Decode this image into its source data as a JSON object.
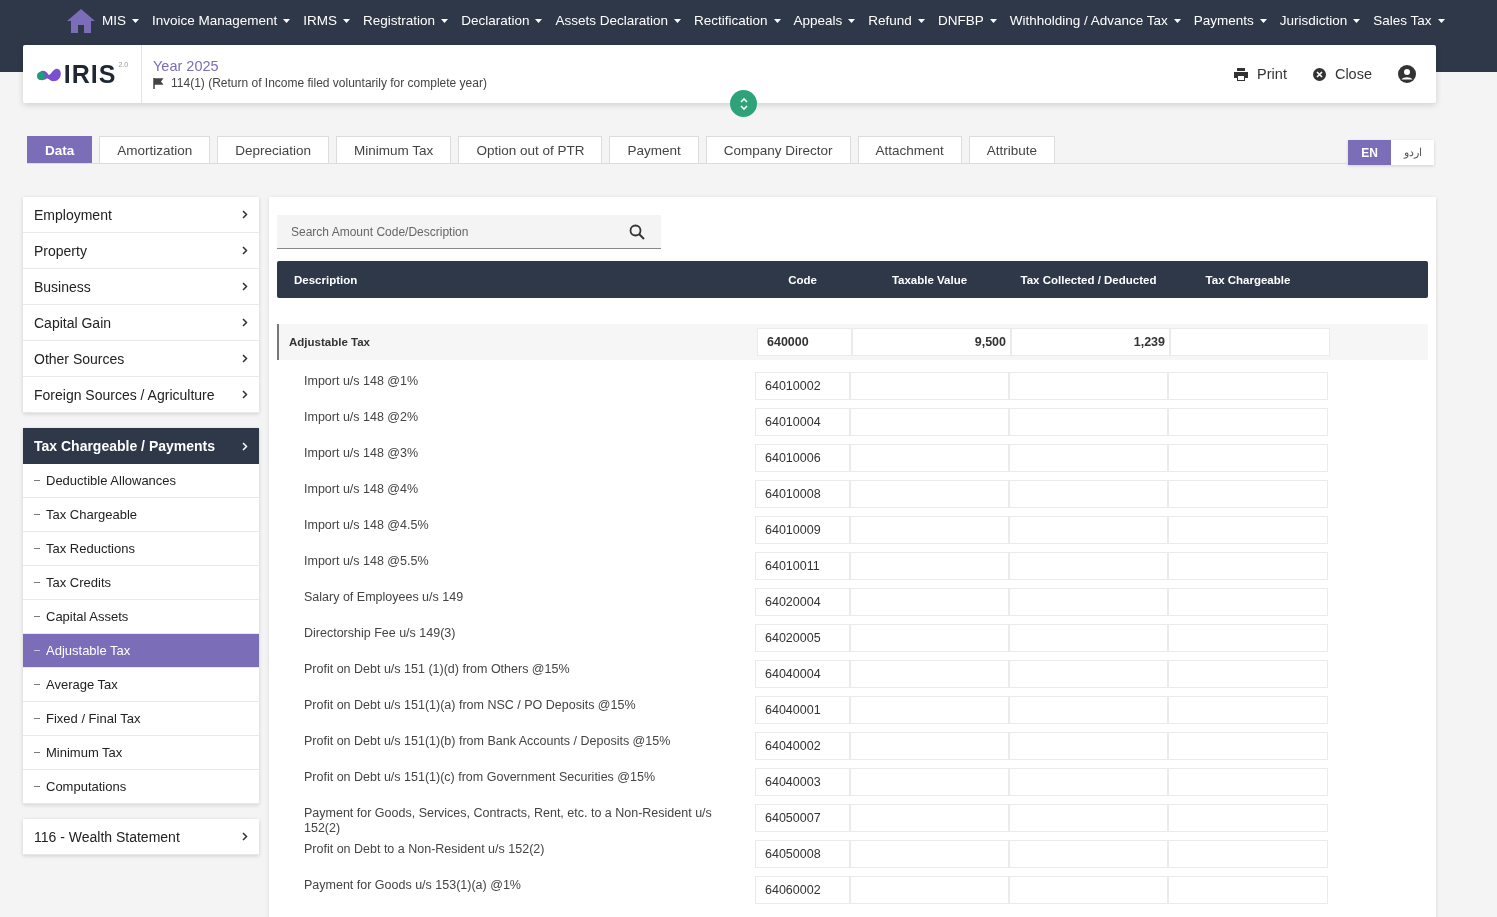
{
  "nav": {
    "items": [
      {
        "label": "MIS"
      },
      {
        "label": "Invoice Management"
      },
      {
        "label": "IRMS"
      },
      {
        "label": "Registration"
      },
      {
        "label": "Declaration"
      },
      {
        "label": "Assets Declaration"
      },
      {
        "label": "Rectification"
      },
      {
        "label": "Appeals"
      },
      {
        "label": "Refund"
      },
      {
        "label": "DNFBP"
      },
      {
        "label": "Withholding / Advance Tax"
      },
      {
        "label": "Payments"
      },
      {
        "label": "Jurisdiction"
      },
      {
        "label": "Sales Tax"
      }
    ]
  },
  "header": {
    "logo": {
      "text": "IRIS",
      "version": "2.0"
    },
    "title": "Year 2025",
    "subtitle": "114(1) (Return of Income filed voluntarily for complete year)",
    "actions": [
      {
        "kind": "print",
        "label": "Print"
      },
      {
        "kind": "close",
        "label": "Close"
      },
      {
        "kind": "user"
      }
    ]
  },
  "tabs": [
    {
      "label": "Data",
      "selected": true
    },
    {
      "label": "Amortization",
      "selected": false
    },
    {
      "label": "Depreciation",
      "selected": false
    },
    {
      "label": "Minimum Tax",
      "selected": false
    },
    {
      "label": "Option out of PTR",
      "selected": false
    },
    {
      "label": "Payment",
      "selected": false
    },
    {
      "label": "Company Director",
      "selected": false
    },
    {
      "label": "Attachment",
      "selected": false
    },
    {
      "label": "Attribute",
      "selected": false
    }
  ],
  "languages": [
    {
      "label": "EN",
      "selected": true
    },
    {
      "label": "اردو",
      "selected": false
    }
  ],
  "sidebar": {
    "groups": [
      {
        "kind": "list",
        "items": [
          {
            "label": "Employment"
          },
          {
            "label": "Property"
          },
          {
            "label": "Business"
          },
          {
            "label": "Capital Gain"
          },
          {
            "label": "Other Sources"
          },
          {
            "label": "Foreign Sources / Agriculture"
          }
        ]
      },
      {
        "kind": "section",
        "label": "Tax Chargeable / Payments",
        "children": [
          {
            "label": "Deductible Allowances",
            "selected": false
          },
          {
            "label": "Tax Chargeable",
            "selected": false
          },
          {
            "label": "Tax Reductions",
            "selected": false
          },
          {
            "label": "Tax Credits",
            "selected": false
          },
          {
            "label": "Capital Assets",
            "selected": false
          },
          {
            "label": "Adjustable Tax",
            "selected": true
          },
          {
            "label": "Average Tax",
            "selected": false
          },
          {
            "label": "Fixed / Final Tax",
            "selected": false
          },
          {
            "label": "Minimum Tax",
            "selected": false
          },
          {
            "label": "Computations",
            "selected": false
          }
        ]
      },
      {
        "kind": "list",
        "items": [
          {
            "label": "116 - Wealth Statement"
          }
        ]
      }
    ]
  },
  "search": {
    "placeholder": "Search Amount Code/Description"
  },
  "table": {
    "columns": [
      "Description",
      "Code",
      "Taxable Value",
      "Tax Collected / Deducted",
      "Tax Chargeable"
    ],
    "group": {
      "description": "Adjustable Tax",
      "code": "640000",
      "taxable_value": "9,500",
      "tax_collected": "1,239"
    },
    "rows": [
      {
        "description": "Import u/s 148 @1%",
        "code": "64010002"
      },
      {
        "description": "Import u/s 148 @2%",
        "code": "64010004"
      },
      {
        "description": "Import u/s 148 @3%",
        "code": "64010006"
      },
      {
        "description": "Import u/s 148 @4%",
        "code": "64010008"
      },
      {
        "description": "Import u/s 148 @4.5%",
        "code": "64010009"
      },
      {
        "description": "Import u/s 148 @5.5%",
        "code": "64010011"
      },
      {
        "description": "Salary of Employees u/s 149",
        "code": "64020004"
      },
      {
        "description": "Directorship Fee u/s 149(3)",
        "code": "64020005"
      },
      {
        "description": "Profit on Debt u/s 151 (1)(d) from Others @15%",
        "code": "64040004"
      },
      {
        "description": "Profit on Debt u/s 151(1)(a) from NSC / PO Deposits @15%",
        "code": "64040001"
      },
      {
        "description": "Profit on Debt u/s 151(1)(b) from Bank Accounts / Deposits @15%",
        "code": "64040002"
      },
      {
        "description": "Profit on Debt u/s 151(1)(c) from Government Securities @15%",
        "code": "64040003"
      },
      {
        "description": "Payment for Goods, Services, Contracts, Rent, etc. to a Non-Resident u/s 152(2)",
        "code": "64050007"
      },
      {
        "description": "Profit on Debt to a Non-Resident u/s 152(2)",
        "code": "64050008"
      },
      {
        "description": "Payment for Goods u/s 153(1)(a) @1%",
        "code": "64060002"
      }
    ]
  }
}
